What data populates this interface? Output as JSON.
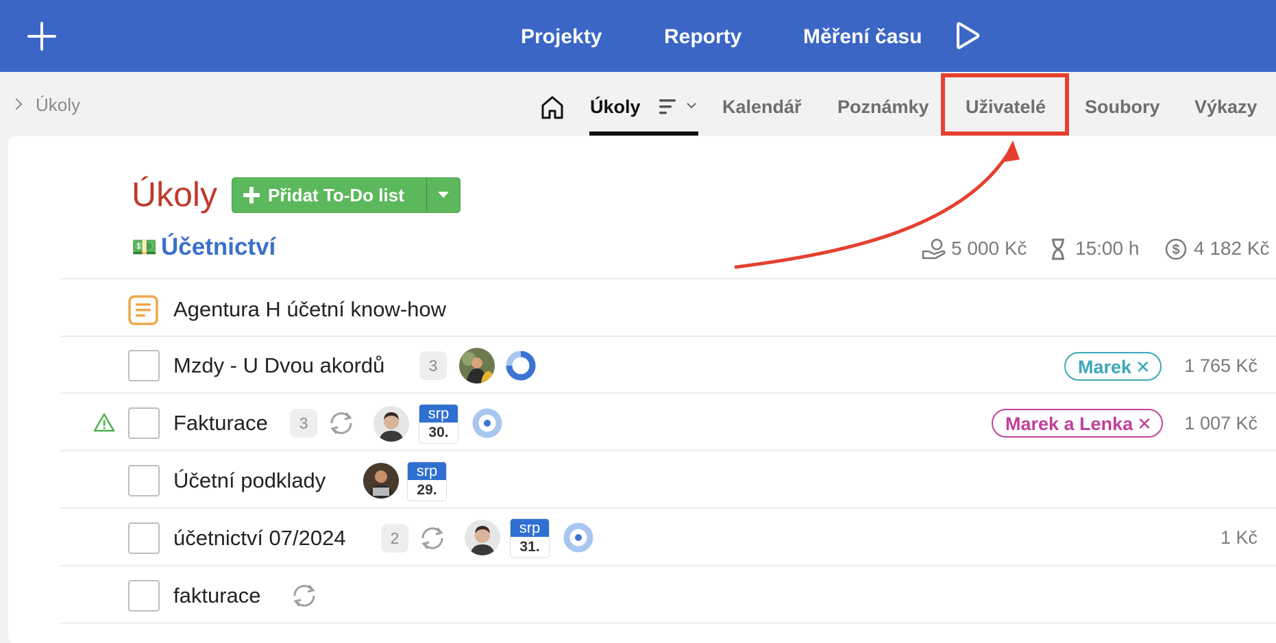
{
  "topbar": {
    "nav": [
      "Projekty",
      "Reporty",
      "Měření času"
    ],
    "colors": {
      "background": "#3b66c6",
      "text": "#ffffff"
    }
  },
  "breadcrumb": {
    "label": "Úkoly"
  },
  "tabs": {
    "active": "Úkoly",
    "items": [
      "Úkoly",
      "Kalendář",
      "Poznámky",
      "Uživatelé",
      "Soubory",
      "Výkazy"
    ],
    "highlighted": "Uživatelé"
  },
  "page": {
    "title": "Úkoly",
    "add_button_label": "Přidat To-Do list"
  },
  "section": {
    "emoji": "💵",
    "title": "Účetnictví",
    "stats": {
      "budget": "5 000 Kč",
      "time": "15:00 h",
      "cost": "4 182 Kč"
    }
  },
  "rows": [
    {
      "type": "note",
      "name": "Agentura H účetní know-how"
    },
    {
      "type": "task",
      "name": "Mzdy - U Dvou akordů",
      "count": "3",
      "progress": 0.75,
      "tag": "Marek",
      "tag_color": "#3aa8b8",
      "amount": "1 765 Kč"
    },
    {
      "type": "task",
      "name": "Fakturace",
      "count": "3",
      "warning": true,
      "repeat": true,
      "date_month": "srp",
      "date_day": "30.",
      "progress": 0.0,
      "tag": "Marek a Lenka",
      "tag_color": "#c0409a",
      "amount": "1 007 Kč"
    },
    {
      "type": "task",
      "name": "Účetní podklady",
      "date_month": "srp",
      "date_day": "29."
    },
    {
      "type": "task",
      "name": "účetnictví 07/2024",
      "count": "2",
      "repeat": true,
      "date_month": "srp",
      "date_day": "31.",
      "progress": 0.0,
      "amount": "1 Kč"
    },
    {
      "type": "task",
      "name": "fakturace",
      "repeat": true
    }
  ],
  "accent_colors": {
    "title": "#c0392b",
    "section": "#3a70c9",
    "add_button": "#5cb85c",
    "highlight": "#e5402f"
  }
}
